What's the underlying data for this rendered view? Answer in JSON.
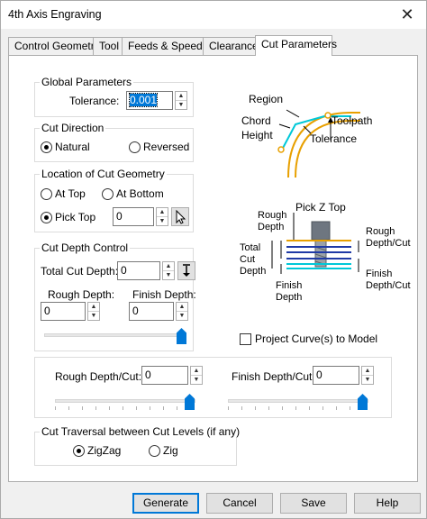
{
  "window": {
    "title": "4th Axis Engraving",
    "close_glyph": "✕"
  },
  "tabs": [
    {
      "label": "Control Geometry"
    },
    {
      "label": "Tool"
    },
    {
      "label": "Feeds & Speeds"
    },
    {
      "label": "Clearance"
    },
    {
      "label": "Cut Parameters",
      "active": true
    }
  ],
  "global": {
    "title": "Global Parameters",
    "tolerance_label": "Tolerance:",
    "tolerance_value": "0.001"
  },
  "cut_direction": {
    "title": "Cut Direction",
    "options": [
      "Natural",
      "Reversed"
    ],
    "selected": "Natural"
  },
  "location": {
    "title": "Location of Cut Geometry",
    "options": [
      "At Top",
      "At Bottom",
      "Pick Top"
    ],
    "selected": "Pick Top",
    "pick_value": "0"
  },
  "depth": {
    "title": "Cut Depth Control",
    "total_label": "Total Cut Depth:",
    "total_value": "0",
    "rough_label": "Rough Depth:",
    "rough_value": "0",
    "finish_label": "Finish Depth:",
    "finish_value": "0",
    "slider_level": 1.0
  },
  "percut": {
    "rough_label": "Rough Depth/Cut:",
    "rough_value": "0",
    "rough_slider_level": 1.0,
    "finish_label": "Finish Depth/Cut:",
    "finish_value": "0",
    "finish_slider_level": 1.0
  },
  "project": {
    "label": "Project Curve(s) to Model",
    "checked": false
  },
  "traversal": {
    "title": "Cut Traversal between Cut Levels (if any)",
    "options": [
      "ZigZag",
      "Zig"
    ],
    "selected": "ZigZag"
  },
  "diagram1": {
    "region": "Region",
    "chord": "Chord",
    "height": "Height",
    "toolpath": "Toolpath",
    "tolerance": "Tolerance"
  },
  "diagram2": {
    "pick_z_top": "Pick Z Top",
    "rough1": "Rough",
    "depth1": "Depth",
    "total": "Total",
    "cut": "Cut",
    "depth2": "Depth",
    "rough_percut_1": "Rough",
    "rough_percut_2": "Depth/Cut",
    "finish_percut_1": "Finish",
    "finish_percut_2": "Depth/Cut",
    "finish_1": "Finish",
    "finish_2": "Depth"
  },
  "colors": {
    "accent": "#0078d7",
    "curve_orange": "#e8a000",
    "curve_cyan": "#00c8d8"
  },
  "buttons": {
    "generate": "Generate",
    "cancel": "Cancel",
    "save": "Save",
    "help": "Help"
  }
}
